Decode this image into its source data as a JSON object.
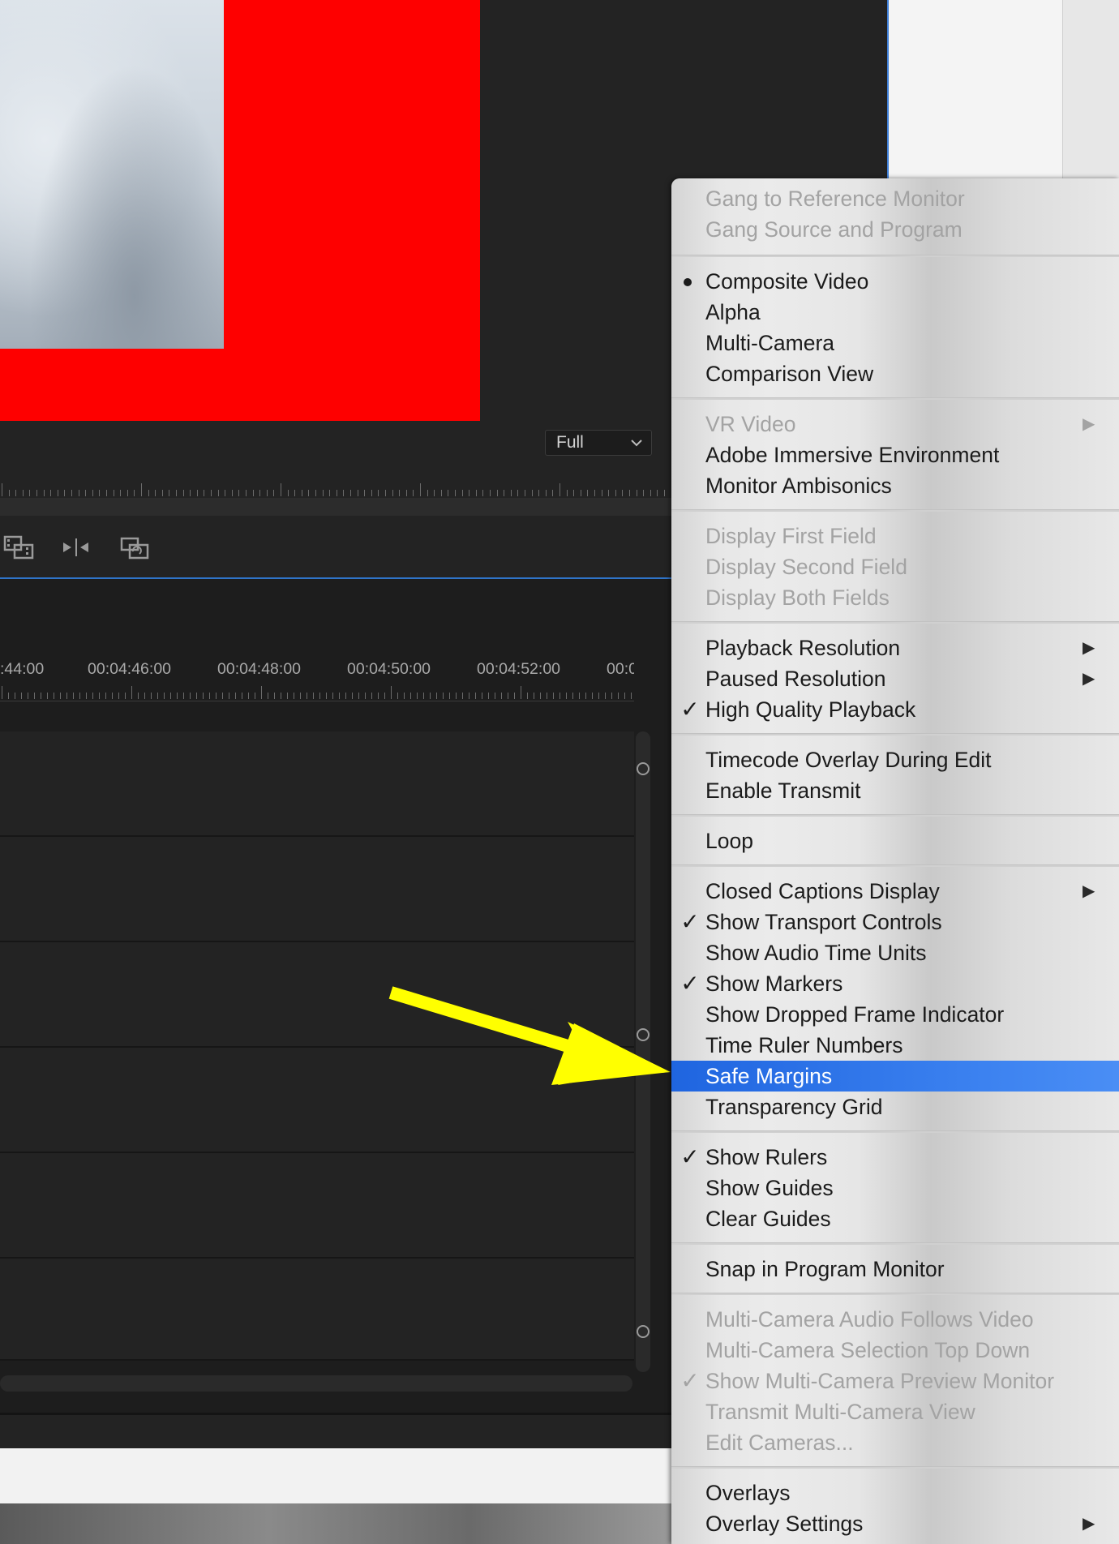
{
  "monitor": {
    "zoom_value": "Full"
  },
  "timeline": {
    "timecodes": [
      ":44:00",
      "00:04:46:00",
      "00:04:48:00",
      "00:04:50:00",
      "00:04:52:00",
      "00:0"
    ]
  },
  "menu": {
    "items": [
      {
        "label": "Gang to Reference Monitor",
        "enabled": false
      },
      {
        "label": "Gang Source and Program",
        "enabled": false
      },
      {
        "label": "Composite Video",
        "enabled": true,
        "mark": "bullet"
      },
      {
        "label": "Alpha",
        "enabled": true
      },
      {
        "label": "Multi-Camera",
        "enabled": true
      },
      {
        "label": "Comparison View",
        "enabled": true
      },
      {
        "label": "VR Video",
        "enabled": false,
        "submenu": true
      },
      {
        "label": "Adobe Immersive Environment",
        "enabled": true
      },
      {
        "label": "Monitor Ambisonics",
        "enabled": true
      },
      {
        "label": "Display First Field",
        "enabled": false
      },
      {
        "label": "Display Second Field",
        "enabled": false
      },
      {
        "label": "Display Both Fields",
        "enabled": false
      },
      {
        "label": "Playback Resolution",
        "enabled": true,
        "submenu": true
      },
      {
        "label": "Paused Resolution",
        "enabled": true,
        "submenu": true
      },
      {
        "label": "High Quality Playback",
        "enabled": true,
        "mark": "check"
      },
      {
        "label": "Timecode Overlay During Edit",
        "enabled": true
      },
      {
        "label": "Enable Transmit",
        "enabled": true
      },
      {
        "label": "Loop",
        "enabled": true
      },
      {
        "label": "Closed Captions Display",
        "enabled": true,
        "submenu": true
      },
      {
        "label": "Show Transport Controls",
        "enabled": true,
        "mark": "check"
      },
      {
        "label": "Show Audio Time Units",
        "enabled": true
      },
      {
        "label": "Show Markers",
        "enabled": true,
        "mark": "check"
      },
      {
        "label": "Show Dropped Frame Indicator",
        "enabled": true
      },
      {
        "label": "Time Ruler Numbers",
        "enabled": true
      },
      {
        "label": "Safe Margins",
        "enabled": true,
        "highlighted": true
      },
      {
        "label": "Transparency Grid",
        "enabled": true
      },
      {
        "label": "Show Rulers",
        "enabled": true,
        "mark": "check"
      },
      {
        "label": "Show Guides",
        "enabled": true
      },
      {
        "label": "Clear Guides",
        "enabled": true
      },
      {
        "label": "Snap in Program Monitor",
        "enabled": true
      },
      {
        "label": "Multi-Camera Audio Follows Video",
        "enabled": false
      },
      {
        "label": "Multi-Camera Selection Top Down",
        "enabled": false
      },
      {
        "label": "Show Multi-Camera Preview Monitor",
        "enabled": false,
        "mark": "check"
      },
      {
        "label": "Transmit Multi-Camera View",
        "enabled": false
      },
      {
        "label": "Edit Cameras...",
        "enabled": false
      },
      {
        "label": "Overlays",
        "enabled": true
      },
      {
        "label": "Overlay Settings",
        "enabled": true,
        "submenu": true
      }
    ],
    "highlight_color": "#2e6fe0"
  },
  "icons": {
    "check": "✓",
    "submenu_arrow": "▶",
    "chevron_down": "⌵"
  },
  "annotation": {
    "arrow_color": "#ffff00"
  }
}
